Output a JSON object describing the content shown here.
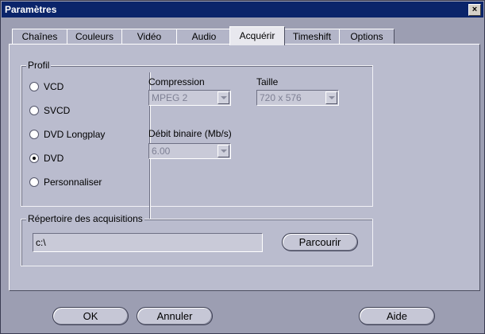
{
  "window": {
    "title": "Paramètres",
    "close_glyph": "×"
  },
  "tabs": [
    {
      "label": "Chaînes"
    },
    {
      "label": "Couleurs"
    },
    {
      "label": "Vidéo"
    },
    {
      "label": "Audio"
    },
    {
      "label": "Acquérir",
      "active": true
    },
    {
      "label": "Timeshift"
    },
    {
      "label": "Options"
    }
  ],
  "profil": {
    "label": "Profil",
    "options": [
      {
        "label": "VCD",
        "selected": false
      },
      {
        "label": "SVCD",
        "selected": false
      },
      {
        "label": "DVD Longplay",
        "selected": false
      },
      {
        "label": "DVD",
        "selected": true
      },
      {
        "label": "Personnaliser",
        "selected": false
      }
    ]
  },
  "compression": {
    "label": "Compression",
    "value": "MPEG 2"
  },
  "taille": {
    "label": "Taille",
    "value": "720 x 576"
  },
  "debit": {
    "label": "Débit binaire (Mb/s)",
    "value": "6.00"
  },
  "repertoire": {
    "label": "Répertoire des acquisitions",
    "path": "c:\\",
    "browse_label": "Parcourir"
  },
  "footer": {
    "ok_label": "OK",
    "cancel_label": "Annuler",
    "help_label": "Aide"
  }
}
